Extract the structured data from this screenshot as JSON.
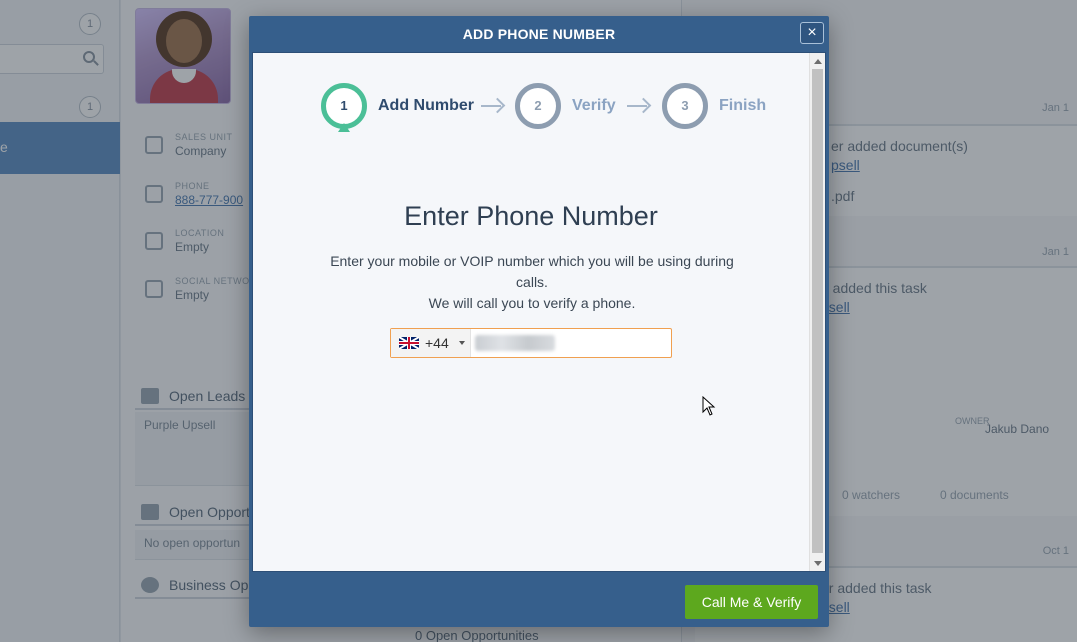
{
  "background": {
    "left_badges": [
      "1",
      "1"
    ],
    "contact": {
      "fields": [
        {
          "label": "SALES UNIT",
          "value": "Company"
        },
        {
          "label": "PHONE",
          "value": "888-777-900"
        },
        {
          "label": "LOCATION",
          "value": "Empty"
        },
        {
          "label": "SOCIAL NETWO",
          "value": "Empty"
        }
      ]
    },
    "sections": [
      {
        "title": "Open Leads",
        "row": "Purple Upsell"
      },
      {
        "title": "Open Opport",
        "row": "No open opportun"
      },
      {
        "title": "Business Op",
        "row": ""
      }
    ],
    "bottom_text": "0 Open Opportunities",
    "activity": {
      "dates": [
        "Jan 1",
        "Jan 1",
        "Oct 1"
      ],
      "items": [
        {
          "text": "er added document(s)",
          "link": "psell",
          "extra": ".pdf"
        },
        {
          "text": "o added this task",
          "link": "psell"
        },
        {
          "text": "er added this task",
          "link": "psell"
        }
      ],
      "owner_label": "OWNER",
      "owner_name": "Jakub Dano",
      "watchers": "0 watchers",
      "documents": "0 documents"
    }
  },
  "modal": {
    "title": "ADD PHONE NUMBER",
    "close_label": "×",
    "steps": [
      {
        "number": "1",
        "label": "Add Number",
        "active": true
      },
      {
        "number": "2",
        "label": "Verify",
        "active": false
      },
      {
        "number": "3",
        "label": "Finish",
        "active": false
      }
    ],
    "heading": "Enter Phone Number",
    "description_line1": "Enter your mobile or VOIP number which you will be using during calls.",
    "description_line2": "We will call you to verify a phone.",
    "phone": {
      "country_flag": "uk-flag-icon",
      "dial_code": "+44",
      "value": "(redacted)"
    },
    "primary_button": "Call Me & Verify"
  },
  "colors": {
    "modal_blue": "#365f8c",
    "step_active": "#4bbf97",
    "step_inactive": "#8d9db0",
    "button_green": "#5da81e",
    "input_focus": "#f0a050"
  }
}
